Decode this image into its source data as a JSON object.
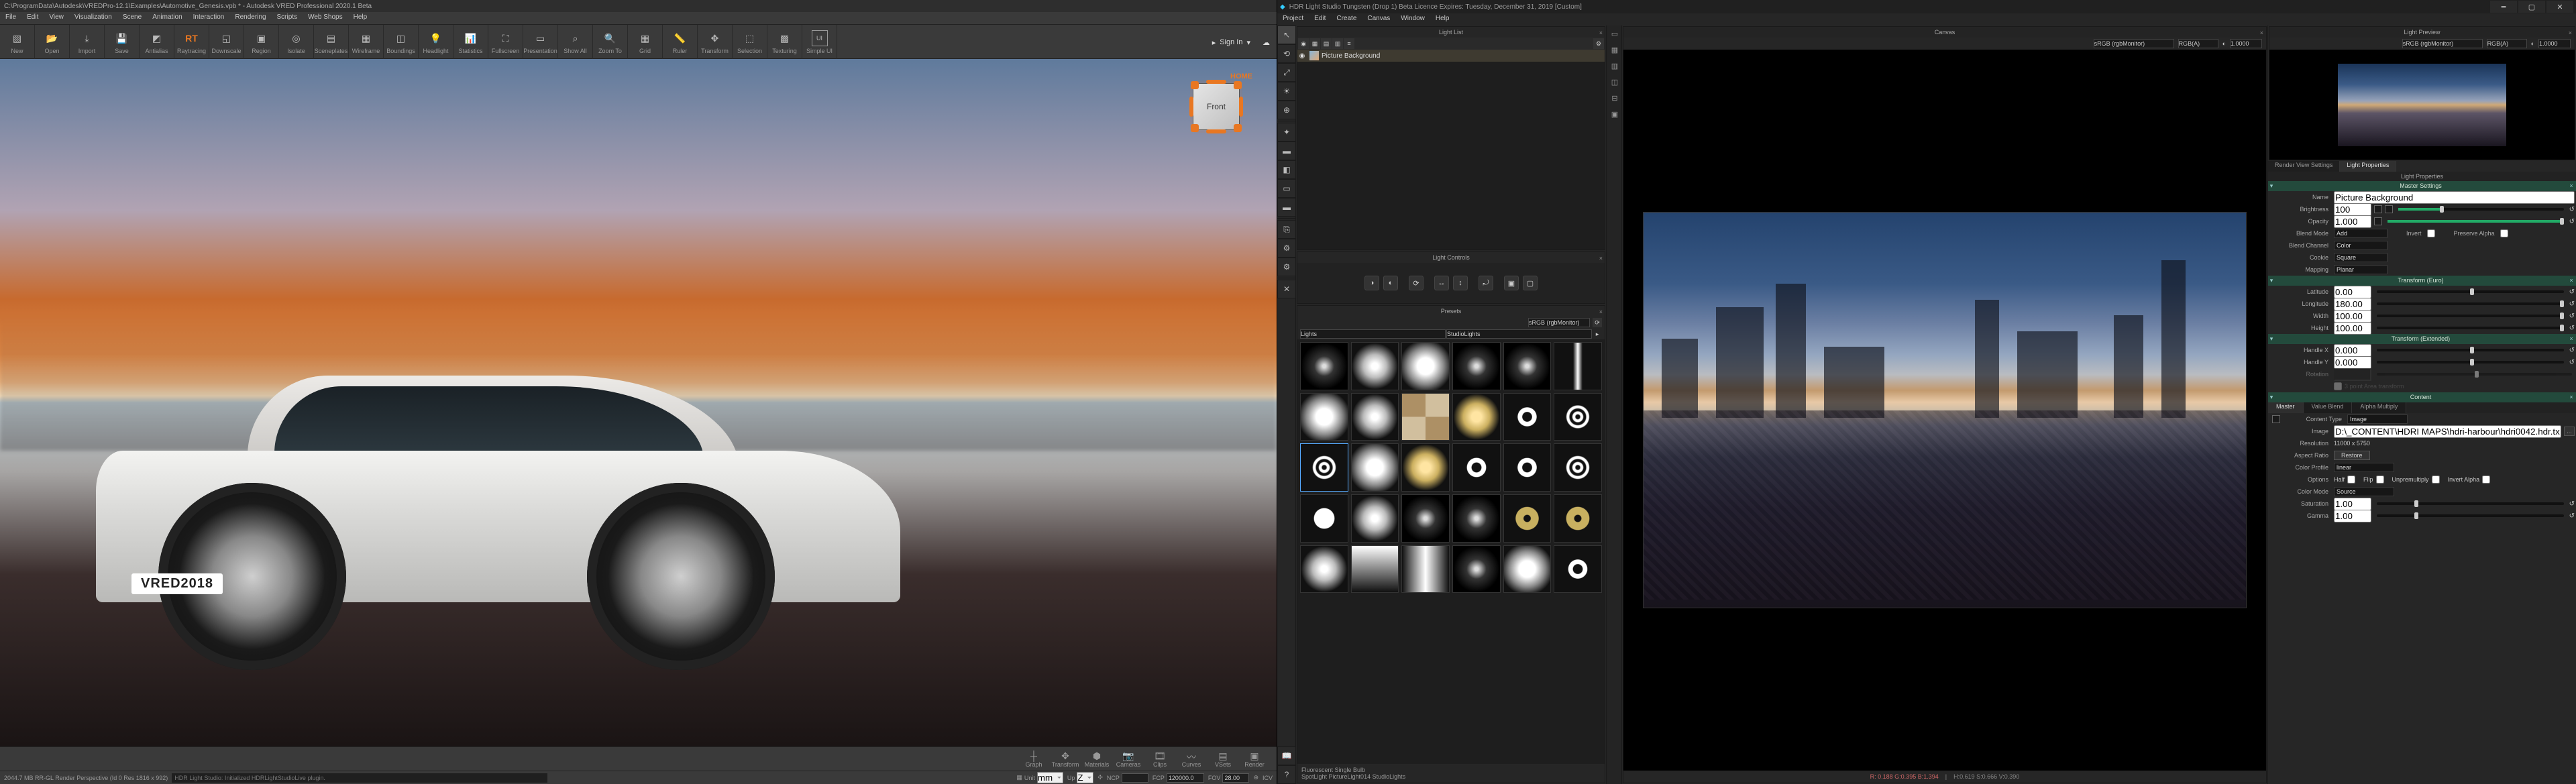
{
  "vred": {
    "title": "C:\\ProgramData\\Autodesk\\VREDPro-12.1\\Examples\\Automotive_Genesis.vpb * - Autodesk VRED Professional 2020.1 Beta",
    "menu": [
      "File",
      "Edit",
      "View",
      "Visualization",
      "Scene",
      "Animation",
      "Interaction",
      "Rendering",
      "Scripts",
      "Web Shops",
      "Help"
    ],
    "toolbar": [
      "New",
      "Open",
      "Import",
      "Save",
      "Antialias",
      "Raytracing",
      "Downscale",
      "Region",
      "Isolate",
      "Sceneplates",
      "Wireframe",
      "Boundings",
      "Headlight",
      "Statistics",
      "Fullscreen",
      "Presentation",
      "Show All",
      "Zoom To",
      "Grid",
      "Ruler",
      "Transform",
      "Selection",
      "Texturing",
      "Simple UI"
    ],
    "signin": "Sign In",
    "viewcube_face": "Front",
    "viewcube_home": "HOME",
    "plate_text": "VRED2018",
    "bottom_toolbar": [
      "Graph",
      "Transform",
      "Materials",
      "Cameras",
      "Clips",
      "Curves",
      "VSets",
      "Render"
    ],
    "statusbar_left": "2044.7 MB   RR-GL   Render Perspective (Id 0 Res 1816 x 992)",
    "log_line": "HDR Light Studio: Initialized HDRLightStudioLive plugin.",
    "bb": {
      "units_l": "Unit",
      "units_v": "mm",
      "up_l": "Up",
      "up_v": "Z",
      "ncp_l": "NCP",
      "fcp_l": "FCP",
      "fcp_v": "120000.0",
      "fov_l": "FOV",
      "fov_v": "28.00",
      "icv": "ICV"
    }
  },
  "hdrls": {
    "title": "HDR Light Studio Tungsten (Drop 1) Beta Licence Expires: Tuesday, December 31, 2019  [Custom]",
    "menu": [
      "Project",
      "Edit",
      "Create",
      "Canvas",
      "Window",
      "Help"
    ],
    "panels": {
      "lightlist": "Light List",
      "canvas": "Canvas",
      "preview": "Light Preview",
      "controls": "Light Controls",
      "presets": "Presets"
    },
    "lightlist_item": "Picture Background",
    "canvas_colorspace": "sRGB (rgbMonitor)",
    "canvas_rgb": "RGB(A)",
    "canvas_exposure": "1.0000",
    "canvas_status": {
      "rgb": "R: 0.188 G:0.395 B:1.394",
      "hsv": "H:0.619 S:0.666 V:0.390"
    },
    "presets_right": "sRGB (rgbMonitor)",
    "presets_cat1": "Lights",
    "presets_cat2": "StudioLights",
    "preset_hover": "Fluorescent Single Bulb",
    "preset_path": "SpotLight PictureLight014 StudioLights",
    "tabs_top": [
      "Render View Settings",
      "Light Properties"
    ],
    "subtabs": [
      "Master",
      "Value Blend",
      "Alpha Multiply"
    ],
    "light_properties_title": "Light Properties",
    "master_settings_head": "Master Settings",
    "transform_euro_head": "Transform (Euro)",
    "transform_ext_head": "Transform (Extended)",
    "content_head": "Content",
    "props": {
      "name_l": "Name",
      "name_v": "Picture Background",
      "brightness_l": "Brightness",
      "brightness_v": "100",
      "opacity_l": "Opacity",
      "opacity_v": "1.000",
      "blendmode_l": "Blend Mode",
      "blendmode_v": "Add",
      "invert_l": "Invert",
      "preserve_l": "Preserve Alpha",
      "blendch_l": "Blend Channel",
      "blendch_v": "Color",
      "cookie_l": "Cookie",
      "cookie_v": "Square",
      "mapping_l": "Mapping",
      "mapping_v": "Planar",
      "lat_l": "Latitude",
      "lat_v": "0.00",
      "lon_l": "Longitude",
      "lon_v": "180.00",
      "width_l": "Width",
      "width_v": "100.00",
      "height_l": "Height",
      "height_v": "100.00",
      "hx_l": "Handle X",
      "hx_v": "0.000",
      "hy_l": "Handle Y",
      "hy_v": "0.000",
      "contenttype_l": "Content Type",
      "contenttype_v": "Image",
      "image_l": "Image",
      "image_v": "D:\\_CONTENT\\HDRI MAPS\\hdri-harbour\\hdri0042.hdr.tx",
      "res_l": "Resolution",
      "res_v": "11000 x 5750",
      "aspect_l": "Aspect Ratio",
      "aspect_btn": "Restore",
      "cprofile_l": "Color Profile",
      "cprofile_v": "linear",
      "options_l": "Options",
      "half_l": "Half",
      "flip_l": "Flip",
      "unpre_l": "Unpremultiply",
      "invalpha_l": "Invert Alpha",
      "cmode_l": "Color Mode",
      "cmode_v": "Source",
      "sat_l": "Saturation",
      "sat_v": "1.00",
      "gamma_l": "Gamma",
      "gamma_v": "1.00"
    }
  }
}
